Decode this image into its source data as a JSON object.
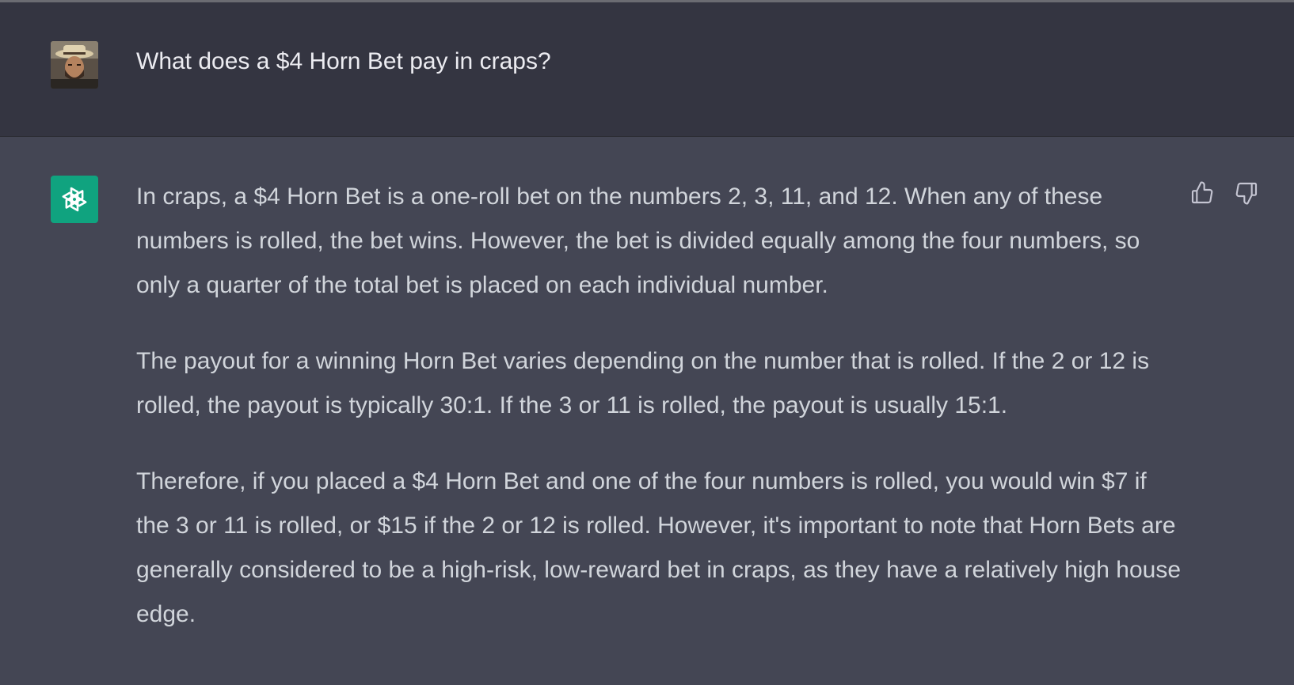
{
  "conversation": {
    "user_message": {
      "text": "What does a $4 Horn Bet pay in craps?",
      "avatar_icon": "user-photo-avatar"
    },
    "assistant_message": {
      "avatar_icon": "openai-logo-icon",
      "avatar_color": "#10a37f",
      "paragraphs": [
        "In craps, a $4 Horn Bet is a one-roll bet on the numbers 2, 3, 11, and 12. When any of these numbers is rolled, the bet wins. However, the bet is divided equally among the four numbers, so only a quarter of the total bet is placed on each individual number.",
        "The payout for a winning Horn Bet varies depending on the number that is rolled. If the 2 or 12 is rolled, the payout is typically 30:1. If the 3 or 11 is rolled, the payout is usually 15:1.",
        "Therefore, if you placed a $4 Horn Bet and one of the four numbers is rolled, you would win $7 if the 3 or 11 is rolled, or $15 if the 2 or 12 is rolled. However, it's important to note that Horn Bets are generally considered to be a high-risk, low-reward bet in craps, as they have a relatively high house edge."
      ],
      "feedback_icons": [
        "thumbs-up-icon",
        "thumbs-down-icon"
      ]
    }
  },
  "colors": {
    "user_bg": "#343541",
    "assistant_bg": "#444654",
    "text": "#d1d5db",
    "accent": "#10a37f"
  }
}
